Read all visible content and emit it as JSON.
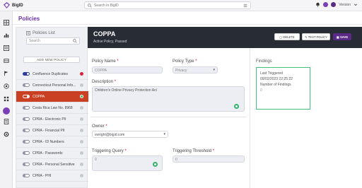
{
  "app": {
    "name": "BigID"
  },
  "topbar": {
    "search_placeholder": "Search in BigID",
    "user_label": "Version"
  },
  "colors": {
    "brand": "#6a2fa8",
    "selected": "#c94122",
    "header": "#282c34",
    "success": "#30b36a"
  },
  "page": {
    "title": "Policies"
  },
  "sidebar": {
    "list_title": "Policies List",
    "search_placeholder": "Search",
    "add_label": "ADD NEW POLICY",
    "items": [
      {
        "label": "Confluence Duplicates",
        "enabled": true,
        "status": "red"
      },
      {
        "label": "Connecticut Personal Info...",
        "enabled": false,
        "status": "grey"
      },
      {
        "label": "COPPA",
        "enabled": true,
        "status": "green",
        "selected": true
      },
      {
        "label": "Costa Rica Law No. 8968",
        "enabled": false,
        "status": "grey"
      },
      {
        "label": "CPRA - Electronic PII",
        "enabled": false,
        "status": "grey"
      },
      {
        "label": "CPRA - Financial PII",
        "enabled": false,
        "status": "grey"
      },
      {
        "label": "CPRA - ID Numbers",
        "enabled": false,
        "status": "grey"
      },
      {
        "label": "CPRA - Passwords",
        "enabled": false,
        "status": "grey"
      },
      {
        "label": "CPRA - Personal Sensitive",
        "enabled": false,
        "status": "grey"
      },
      {
        "label": "CPRA - PHI",
        "enabled": false,
        "status": "grey"
      }
    ]
  },
  "header": {
    "title": "COPPA",
    "subtitle": "Active Policy,  Passed",
    "buttons": {
      "delete": "DELETE",
      "test": "TEST POLICY",
      "save": "SAVE"
    }
  },
  "form": {
    "policy_name_label": "Policy Name",
    "policy_name_value": "COPPA",
    "policy_type_label": "Policy Type",
    "policy_type_value": "Privacy",
    "description_label": "Description",
    "description_value": "Children's Online Privacy Protection Act",
    "owner_label": "Owner",
    "owner_value": "vwright@bigid.com",
    "triggering_query_label": "Triggering Query",
    "triggering_query_value": "0",
    "threshold_label": "Triggering Threshold",
    "threshold_value": "0"
  },
  "findings": {
    "title": "Findings",
    "last_triggered_label": "Last Triggered",
    "last_triggered_value": "09/02/2023 22:25:22",
    "number_label": "Number of Findings",
    "number_value": "0"
  }
}
